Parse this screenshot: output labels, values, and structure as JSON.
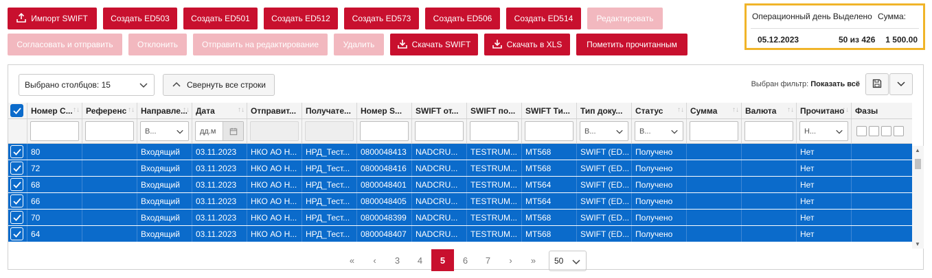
{
  "toolbar": {
    "row1": [
      {
        "label": "Импорт SWIFT",
        "enabled": true,
        "icon": "upload-icon"
      },
      {
        "label": "Создать ED503",
        "enabled": true
      },
      {
        "label": "Создать ED501",
        "enabled": true
      },
      {
        "label": "Создать ED512",
        "enabled": true
      },
      {
        "label": "Создать ED573",
        "enabled": true
      },
      {
        "label": "Создать ED506",
        "enabled": true
      },
      {
        "label": "Создать ED514",
        "enabled": true
      },
      {
        "label": "Редактировать",
        "enabled": false
      }
    ],
    "row2": [
      {
        "label": "Согласовать и отправить",
        "enabled": false
      },
      {
        "label": "Отклонить",
        "enabled": false
      },
      {
        "label": "Отправить на редактирование",
        "enabled": false
      },
      {
        "label": "Удалить",
        "enabled": false
      },
      {
        "label": "Скачать SWIFT",
        "enabled": true,
        "icon": "download-icon"
      },
      {
        "label": "Скачать в XLS",
        "enabled": true,
        "icon": "download-icon"
      },
      {
        "label": "Пометить прочитанным",
        "enabled": true
      }
    ]
  },
  "info": {
    "header_day": "Операционный день",
    "header_selected": "Выделено",
    "header_sum": "Сумма:",
    "date": "05.12.2023",
    "selected": "50 из 426",
    "sum": "1 500.00"
  },
  "grid_toolbar": {
    "columns_selected": "Выбрано столбцов: 15",
    "collapse_label": "Свернуть все строки",
    "filter_prefix": "Выбран фильтр:",
    "filter_value": "Показать всё"
  },
  "columns": [
    "Номер С...",
    "Референс",
    "Направле...",
    "Дата",
    "Отправит...",
    "Получате...",
    "Номер S...",
    "SWIFT от...",
    "SWIFT по...",
    "SWIFT Ти...",
    "Тип доку...",
    "Статус",
    "Сумма",
    "Валюта",
    "Прочитано",
    "Фазы"
  ],
  "filters": {
    "direction": "В...",
    "date_placeholder": "дд.м",
    "doc_type": "В...",
    "status": "В...",
    "read": "Н..."
  },
  "rows": [
    [
      "80",
      "",
      "Входящий",
      "03.11.2023",
      "НКО АО Н...",
      "НРД_Тест...",
      "0800048413",
      "NADCRU...",
      "TESTRUM...",
      "MT568",
      "SWIFT (ED...",
      "Получено",
      "",
      "",
      "Нет",
      ""
    ],
    [
      "72",
      "",
      "Входящий",
      "03.11.2023",
      "НКО АО Н...",
      "НРД_Тест...",
      "0800048416",
      "NADCRU...",
      "TESTRUM...",
      "MT568",
      "SWIFT (ED...",
      "Получено",
      "",
      "",
      "Нет",
      ""
    ],
    [
      "68",
      "",
      "Входящий",
      "03.11.2023",
      "НКО АО Н...",
      "НРД_Тест...",
      "0800048401",
      "NADCRU...",
      "TESTRUM...",
      "MT564",
      "SWIFT (ED...",
      "Получено",
      "",
      "",
      "Нет",
      ""
    ],
    [
      "66",
      "",
      "Входящий",
      "03.11.2023",
      "НКО АО Н...",
      "НРД_Тест...",
      "0800048405",
      "NADCRU...",
      "TESTRUM...",
      "MT564",
      "SWIFT (ED...",
      "Получено",
      "",
      "",
      "Нет",
      ""
    ],
    [
      "70",
      "",
      "Входящий",
      "03.11.2023",
      "НКО АО Н...",
      "НРД_Тест...",
      "0800048399",
      "NADCRU...",
      "TESTRUM...",
      "MT568",
      "SWIFT (ED...",
      "Получено",
      "",
      "",
      "Нет",
      ""
    ],
    [
      "64",
      "",
      "Входящий",
      "03.11.2023",
      "НКО АО Н...",
      "НРД_Тест...",
      "0800048407",
      "NADCRU...",
      "TESTRUM...",
      "MT568",
      "SWIFT (ED...",
      "Получено",
      "",
      "",
      "Нет",
      ""
    ]
  ],
  "pager": {
    "first": "«",
    "prev": "‹",
    "pages": [
      "3",
      "4",
      "5",
      "6",
      "7"
    ],
    "current": "5",
    "next": "›",
    "last": "»",
    "page_size": "50"
  },
  "colors": {
    "accent": "#c8102e",
    "selected_row": "#0b6bcb",
    "highlight_border": "#f0b429"
  }
}
